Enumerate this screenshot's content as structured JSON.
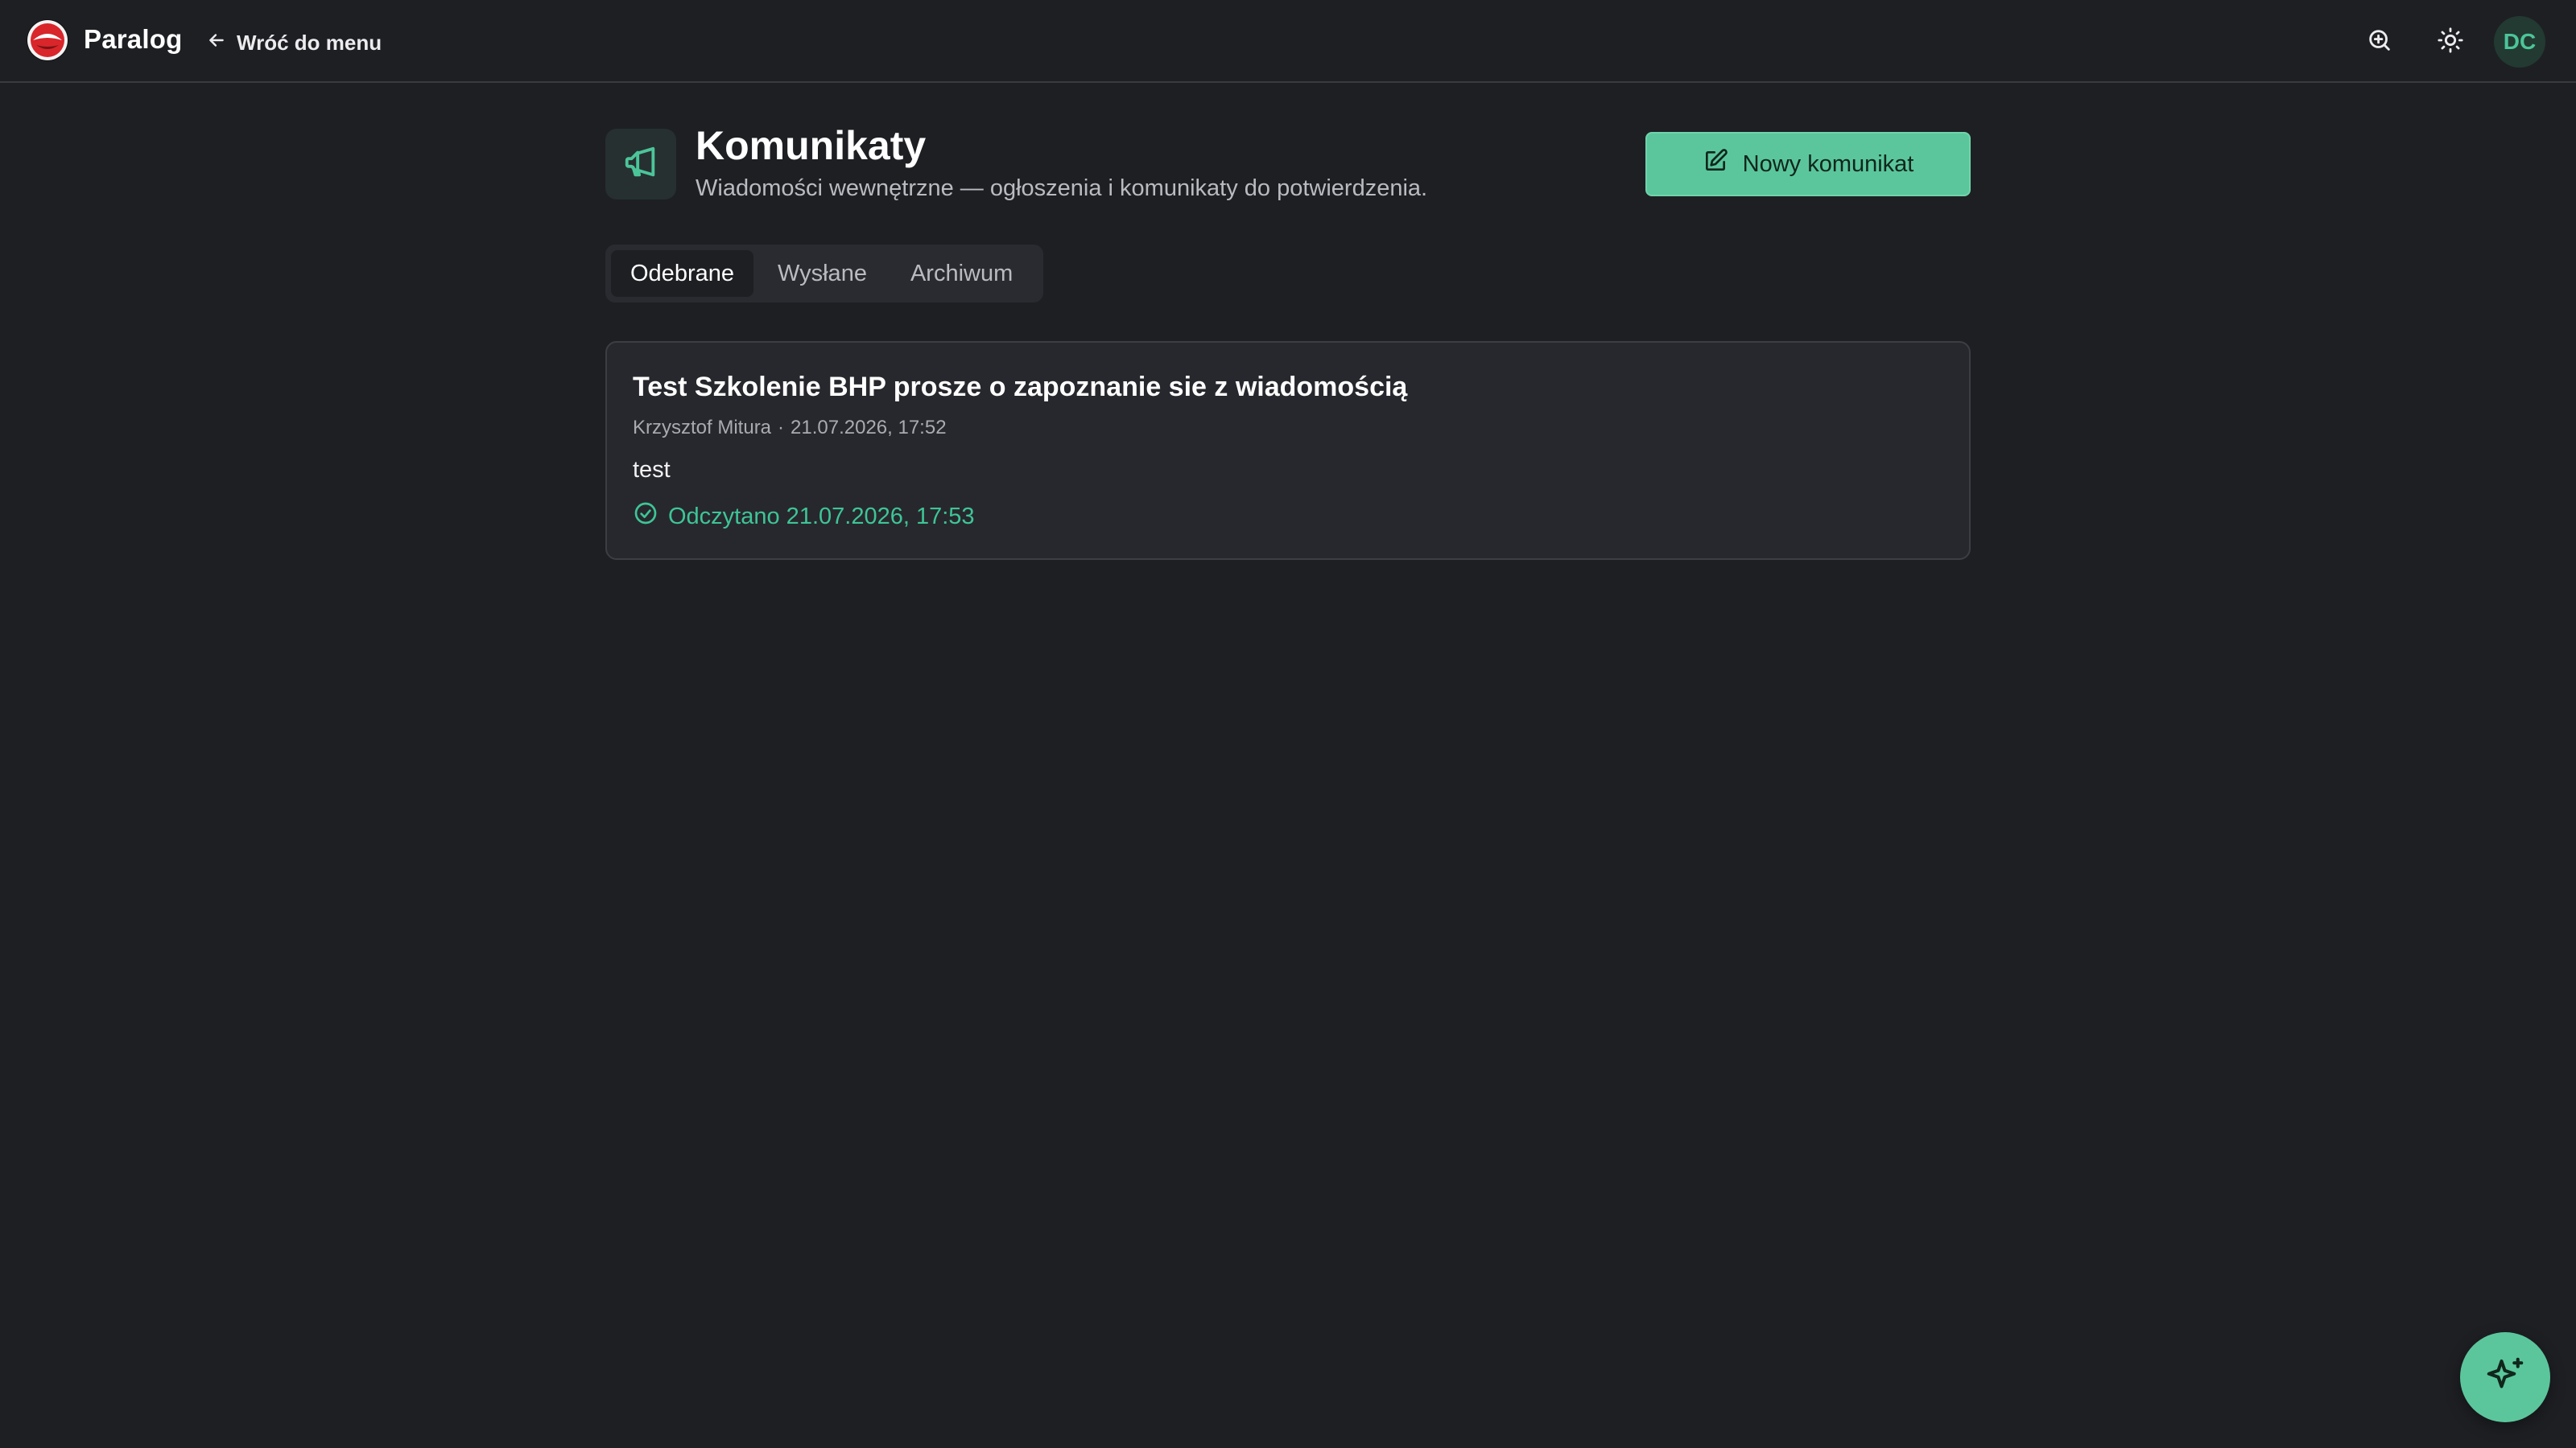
{
  "app": {
    "name": "Paralog",
    "back_label": "Wróć do menu"
  },
  "topbar": {
    "avatar_initials": "DC",
    "icons": [
      "zoom-in-icon",
      "sun-icon"
    ]
  },
  "header": {
    "title": "Komunikaty",
    "subtitle": "Wiadomości wewnętrzne — ogłoszenia i komunikaty do potwierdzenia.",
    "new_button_label": "Nowy komunikat"
  },
  "tabs": [
    {
      "label": "Odebrane",
      "active": true
    },
    {
      "label": "Wysłane",
      "active": false
    },
    {
      "label": "Archiwum",
      "active": false
    }
  ],
  "messages": [
    {
      "title": "Test Szkolenie BHP prosze o zapoznanie sie z wiadomością",
      "author": "Krzysztof Mitura",
      "separator": "·",
      "date": "21.07.2026, 17:52",
      "body": "test",
      "read_status": "Odczytano 21.07.2026, 17:53"
    }
  ],
  "colors": {
    "background": "#1e1f23",
    "accent": "#5bc69c",
    "read_green": "#3ec596",
    "card": "#27282d"
  }
}
